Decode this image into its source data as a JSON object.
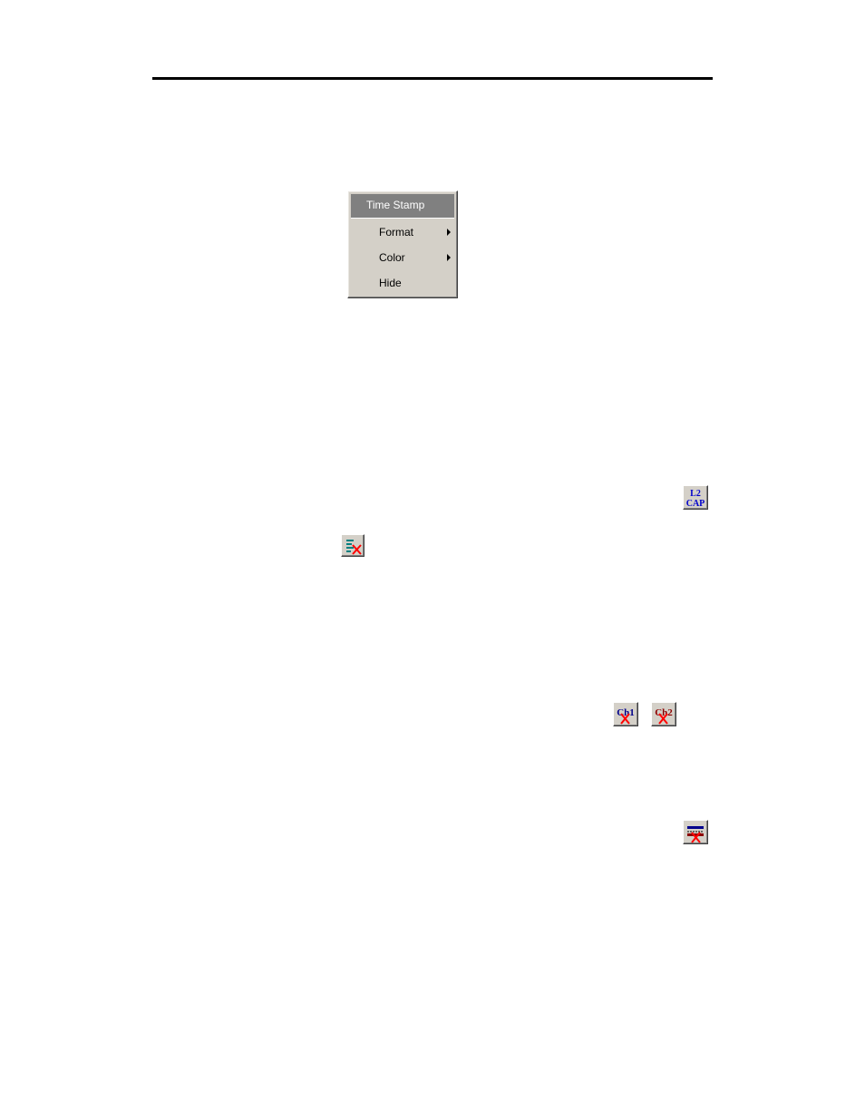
{
  "context_menu": {
    "title": "Time Stamp",
    "items": [
      {
        "label": "Format",
        "has_submenu": true
      },
      {
        "label": "Color",
        "has_submenu": true
      },
      {
        "label": "Hide",
        "has_submenu": false
      }
    ]
  },
  "toolbar_icons": {
    "l2cap": {
      "name": "l2cap-icon",
      "line1": "L2",
      "line2": "CAP",
      "color": "#0000cc"
    },
    "clear_list": {
      "name": "clear-list-icon"
    },
    "ch1": {
      "name": "clear-ch1-icon",
      "text": "Ch1",
      "color": "#00008b"
    },
    "ch2": {
      "name": "clear-ch2-icon",
      "text": "Ch2",
      "color": "#8b0000"
    },
    "clear_both": {
      "name": "clear-both-channels-icon"
    }
  },
  "colors": {
    "menu_bg": "#d4d0c8",
    "menu_header": "#808080",
    "delete_x": "#ff0000"
  }
}
